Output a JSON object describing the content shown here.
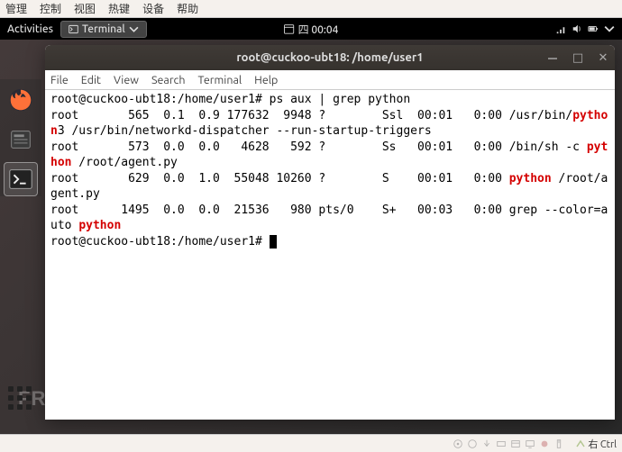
{
  "vbox_menu": [
    "管理",
    "控制",
    "视图",
    "热键",
    "设备",
    "帮助"
  ],
  "gnome": {
    "activities": "Activities",
    "app_label": "Terminal",
    "clock": "四 00:04"
  },
  "window": {
    "title": "root@cuckoo-ubt18: /home/user1",
    "menus": [
      "File",
      "Edit",
      "View",
      "Search",
      "Terminal",
      "Help"
    ]
  },
  "prompt1_pre": "root@cuckoo-ubt18:/home/user1# ",
  "prompt1_cmd": "ps aux | grep python",
  "ps": [
    {
      "pre": "root       565  0.1  0.9 177632  9948 ?        Ssl  00:01   0:00 /usr/bin/",
      "hl": "python",
      "post": "3 /usr/bin/networkd-dispatcher --run-startup-triggers"
    },
    {
      "pre": "root       573  0.0  0.0   4628   592 ?        Ss   00:01   0:00 /bin/sh -c ",
      "hl": "python",
      "post": " /root/agent.py"
    },
    {
      "pre": "root       629  0.0  1.0  55048 10260 ?        S    00:01   0:00 ",
      "hl": "python",
      "post": " /root/agent.py"
    },
    {
      "pre": "root      1495  0.0  0.0  21536   980 pts/0    S+   00:03   0:00 grep --color=auto ",
      "hl": "pyt",
      "post": "",
      "wrap_hl": "hon"
    }
  ],
  "prompt2": "root@cuckoo-ubt18:/home/user1# ",
  "watermark": "FREEBUF",
  "status_host": "右 Ctrl"
}
